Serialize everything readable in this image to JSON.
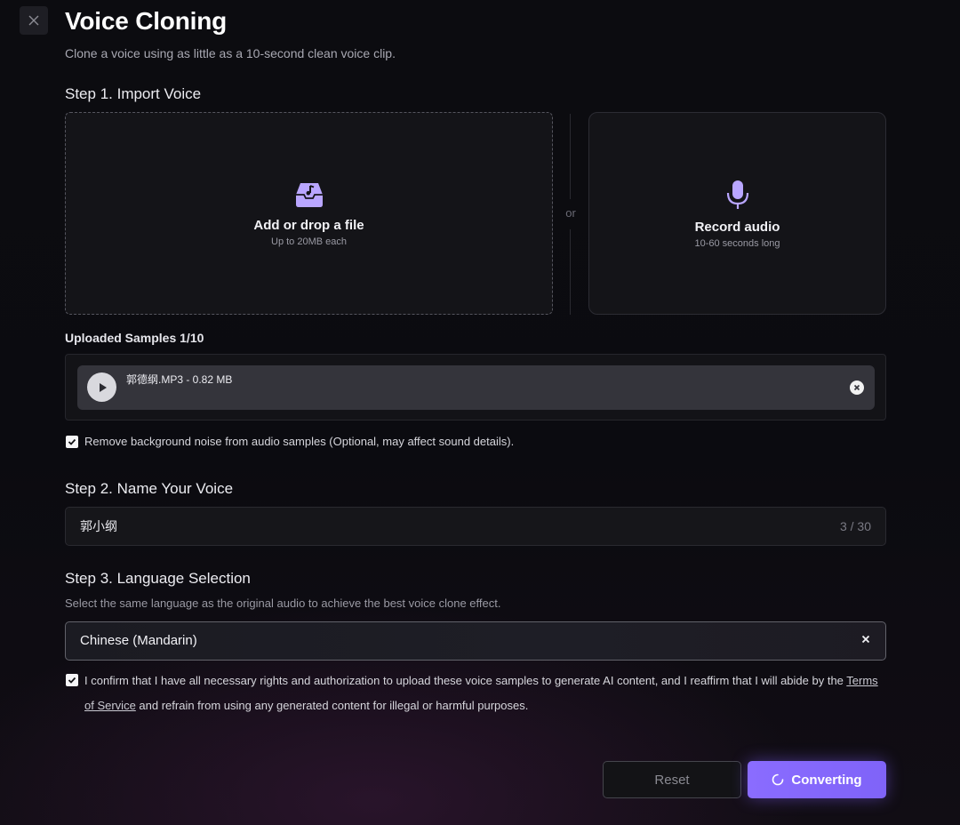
{
  "header": {
    "title": "Voice Cloning",
    "subtitle": "Clone a voice using as little as a 10-second clean voice clip."
  },
  "step1": {
    "title": "Step 1. Import Voice",
    "upload": {
      "label": "Add or drop a file",
      "hint": "Up to 20MB each",
      "icon": "file-inbox-music-icon"
    },
    "divider_text": "or",
    "record": {
      "label": "Record audio",
      "hint": "10-60 seconds long",
      "icon": "microphone-icon"
    }
  },
  "samples": {
    "title": "Uploaded Samples  1/10",
    "items": [
      {
        "name": "郭德纲.MP3 - 0.82 MB"
      }
    ]
  },
  "noise_option": {
    "checked": true,
    "label": "Remove background noise from audio samples (Optional, may affect sound details)."
  },
  "step2": {
    "title": "Step 2. Name Your Voice",
    "value": "郭小纲",
    "char_count": "3 / 30"
  },
  "step3": {
    "title": "Step 3. Language Selection",
    "hint": "Select the same language as the original audio to achieve the best voice clone effect.",
    "selected": "Chinese (Mandarin)"
  },
  "confirm": {
    "checked": true,
    "text_before": "I confirm that I have all necessary rights and authorization to upload these voice samples to generate AI content, and I reaffirm that I will abide by the ",
    "link_text": "Terms of Service",
    "text_after": " and refrain from using any generated content for illegal or harmful purposes."
  },
  "actions": {
    "reset_label": "Reset",
    "convert_label": "Converting"
  },
  "colors": {
    "accent": "#8a6cff",
    "icon_purple": "#b9a6ff"
  }
}
